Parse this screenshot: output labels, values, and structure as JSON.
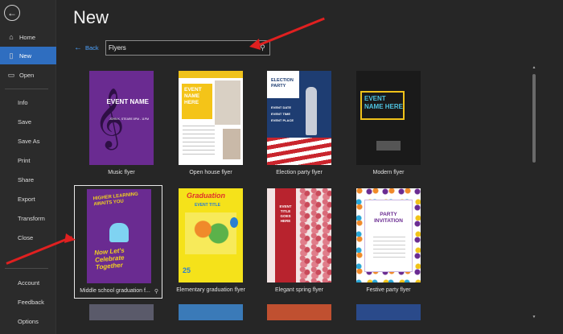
{
  "page": {
    "title": "New"
  },
  "sidebar": {
    "back_icon": "back-arrow-circle-icon",
    "primary": [
      {
        "label": "Home",
        "icon": "home-icon",
        "glyph": "⌂"
      },
      {
        "label": "New",
        "icon": "new-document-icon",
        "glyph": "▯",
        "active": true
      },
      {
        "label": "Open",
        "icon": "folder-open-icon",
        "glyph": "▭"
      }
    ],
    "secondary": [
      "Info",
      "Save",
      "Save As",
      "Print",
      "Share",
      "Export",
      "Transform",
      "Close"
    ],
    "footer": [
      "Account",
      "Feedback",
      "Options"
    ]
  },
  "back_link": {
    "label": "Back"
  },
  "search": {
    "value": "Flyers",
    "icon": "search-icon"
  },
  "templates": [
    {
      "label": "Music flyer",
      "thumb_text": "EVENT NAME",
      "thumb_sub": "JOHN K. STEARE 8PM - 11PM"
    },
    {
      "label": "Open house flyer",
      "thumb_text": "EVENT NAME HERE"
    },
    {
      "label": "Election party flyer",
      "thumb_text": "ELECTION PARTY",
      "thumb_sub": "EVENT DATE EVENT TIME EVENT PLACE"
    },
    {
      "label": "Modern flyer",
      "thumb_text": "EVENT NAME HERE"
    },
    {
      "label": "Middle school graduation f...",
      "thumb_text": "HIGHER LEARNING AWAITS YOU",
      "thumb_sub": "Now Let's Celebrate Together",
      "selected": true
    },
    {
      "label": "Elementary graduation flyer",
      "thumb_text": "Graduation",
      "thumb_sub": "EVENT TITLE",
      "date": "25"
    },
    {
      "label": "Elegant spring flyer",
      "thumb_text": "EVENT TITLE GOES HERE"
    },
    {
      "label": "Festive party flyer",
      "thumb_text": "PARTY INVITATION"
    }
  ],
  "colors": {
    "accent": "#2f6ec0",
    "link": "#4da3ff",
    "annotation_arrow": "#e02020"
  }
}
